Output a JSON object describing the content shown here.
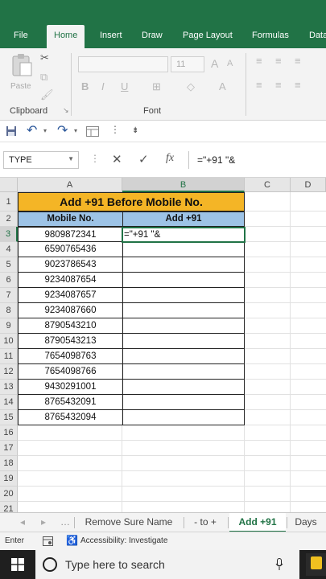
{
  "ribbon_tabs": [
    "File",
    "Home",
    "Insert",
    "Draw",
    "Page Layout",
    "Formulas",
    "Data"
  ],
  "ribbon": {
    "paste_label": "Paste",
    "group_clipboard": "Clipboard",
    "group_font": "Font",
    "font_size": "11",
    "bold": "B",
    "italic": "I",
    "underline": "U",
    "grow": "A",
    "shrink": "A",
    "font_color": "A"
  },
  "formula_bar": {
    "name_box": "TYPE",
    "cancel": "✕",
    "enter": "✓",
    "fx": "fx",
    "formula": "=\"+91 \"&"
  },
  "columns": [
    "A",
    "B",
    "C",
    "D"
  ],
  "rows": [
    "1",
    "2",
    "3",
    "4",
    "5",
    "6",
    "7",
    "8",
    "9",
    "10",
    "11",
    "12",
    "13",
    "14",
    "15",
    "16",
    "17",
    "18",
    "19",
    "20",
    "21"
  ],
  "sheet": {
    "title": "Add +91 Before Mobile No.",
    "header_a": "Mobile No.",
    "header_b": "Add +91",
    "editing_text": "=\"+91 \"&",
    "numbers": [
      "9809872341",
      "6590765436",
      "9023786543",
      "9234087654",
      "9234087657",
      "9234087660",
      "8790543210",
      "8790543213",
      "7654098763",
      "7654098766",
      "9430291001",
      "8765432091",
      "8765432094"
    ]
  },
  "sheet_tabs": [
    "Remove Sure Name",
    "- to +",
    "Add +91",
    "Days"
  ],
  "status": {
    "mode": "Enter",
    "accessibility": "Accessibility: Investigate"
  },
  "taskbar": {
    "search_placeholder": "Type here to search"
  },
  "colors": {
    "excel_green": "#217346",
    "title_fill": "#f4b526",
    "header_fill": "#9dc3e6"
  }
}
